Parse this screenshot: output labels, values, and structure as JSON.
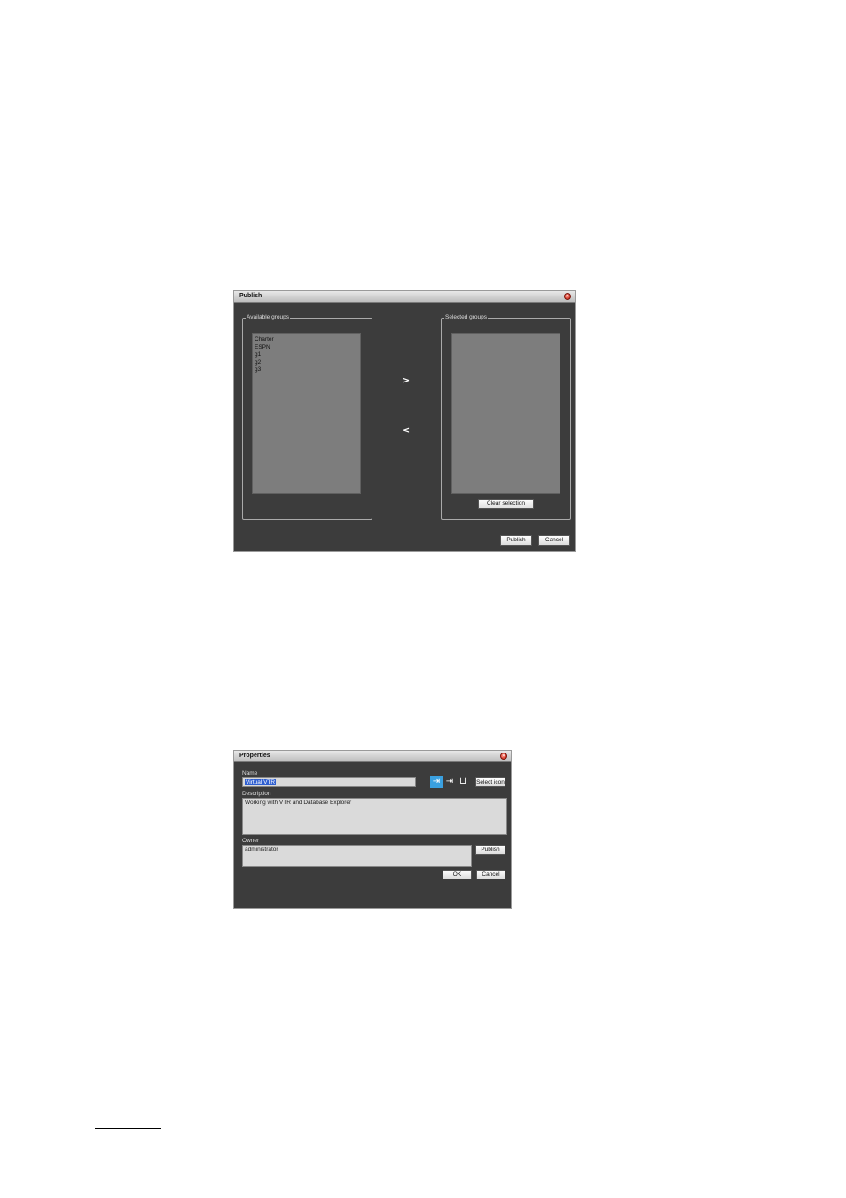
{
  "publish_dialog": {
    "title": "Publish",
    "available_groups": {
      "legend": "Available groups",
      "items": [
        "Charter",
        "ESPN",
        "g1",
        "g2",
        "g3"
      ]
    },
    "selected_groups": {
      "legend": "Selected groups",
      "clear_label": "Clear selection"
    },
    "add_arrow": ">",
    "remove_arrow": "<",
    "publish_label": "Publish",
    "cancel_label": "Cancel"
  },
  "properties_dialog": {
    "title": "Properties",
    "name_label": "Name",
    "name_value": "Virtual VTR",
    "select_icon_label": "Select icon",
    "description_label": "Description",
    "description_value": "Working with VTR and Database Explorer",
    "owner_label": "Owner",
    "owner_value": "administrator",
    "publish_label": "Publish",
    "ok_label": "OK",
    "cancel_label": "Cancel"
  }
}
